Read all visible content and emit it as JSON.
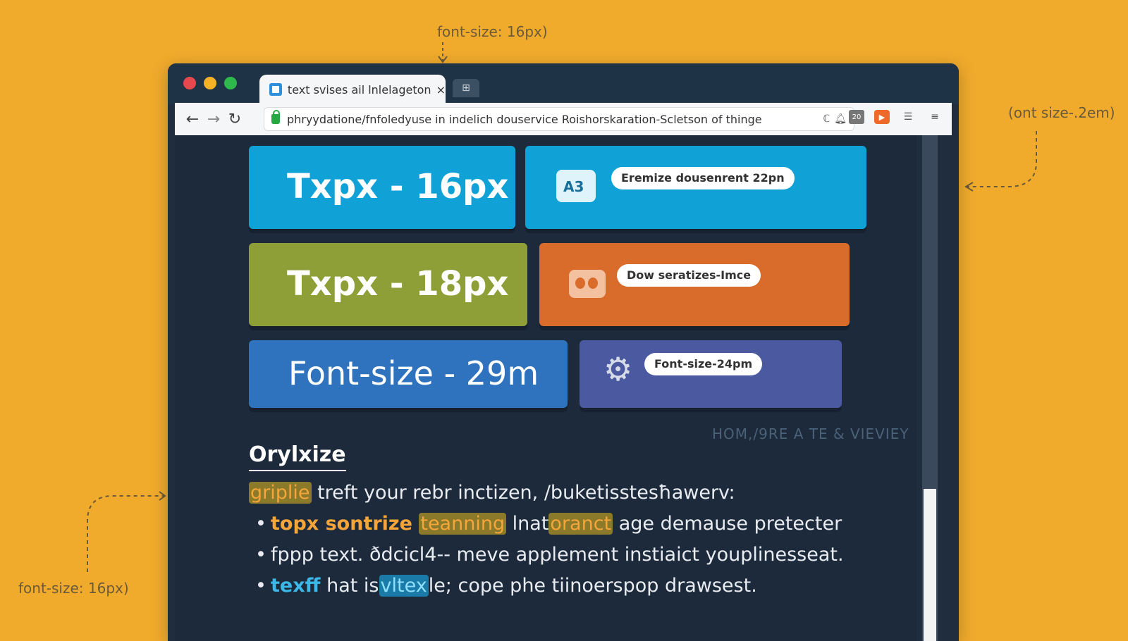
{
  "annotations": {
    "top": "font-size: 16px)",
    "right": "(ont size-.2em)",
    "left": "font-size: 16px)"
  },
  "browser": {
    "tab_title": "text svises ail lnlelageton",
    "tab_close": "×",
    "new_tab": "⊞",
    "url": "phryydatione/fnfoledyuse in indelich douservice Roishorskaration-Scletson of thinge",
    "omni_end": "ℂ",
    "calendar_label": "20"
  },
  "cards": [
    {
      "text": "Txpx - 16px",
      "color": "#10a2d6"
    },
    {
      "pill": "Eremize dousenrent 22pn",
      "icon_text": "A3",
      "color": "#10a2d6"
    },
    {
      "text": "Txpx - 18px",
      "color": "#8e9f38"
    },
    {
      "pill": "Dow seratizes-Imce",
      "color": "#d96b2b"
    },
    {
      "text": "Font-size - 29m",
      "color": "#2f72bd"
    },
    {
      "pill": "Font-size-24pm",
      "color": "#4b5aa0"
    }
  ],
  "watermark": "HOM,/9RE A TE & VIEVIEY",
  "article": {
    "heading": "Orylxize",
    "line1": {
      "hl": "griplie",
      "rest": " treft your rebr inctizen, /buketisstesħawerv:"
    },
    "line2": {
      "bullet": "•",
      "a": "topx sontrize ",
      "hl1": "teanning",
      "b": " lnat",
      "hl2": "oranct",
      "c": " age demause pretecter"
    },
    "line3": {
      "bullet": "•",
      "text": "fppp text. ðdcicl4-- meve applement instiaict youplinesseat."
    },
    "line4": {
      "bullet": "•",
      "a": "texff",
      "b": " hat is",
      "hl": "vltex",
      "c": "le; cope phe tiinoerspop drawsest."
    }
  }
}
